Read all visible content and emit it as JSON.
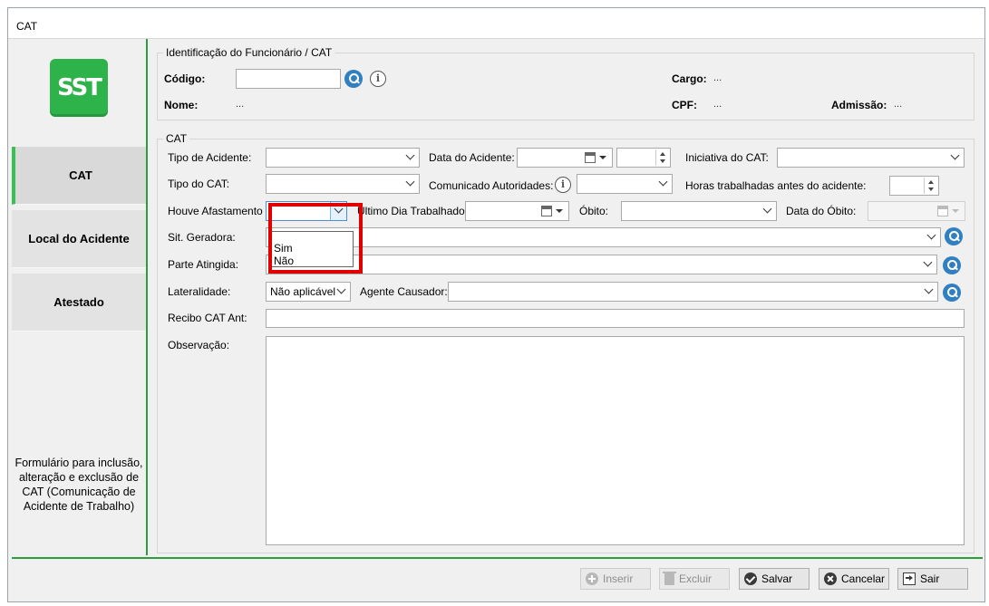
{
  "window": {
    "title": "CAT"
  },
  "sidebar": {
    "logo_text": "SST",
    "logo_color": "#2db34a",
    "items": [
      {
        "label": "CAT",
        "active": true
      },
      {
        "label": "Local do Acidente",
        "active": false
      },
      {
        "label": "Atestado",
        "active": false
      }
    ],
    "description": "Formulário para inclusão, alteração e exclusão de CAT (Comunicação de Acidente de Trabalho)"
  },
  "identificacao": {
    "legend": "Identificação do Funcionário / CAT",
    "codigo_label": "Código:",
    "codigo_value": "",
    "nome_label": "Nome:",
    "nome_value": "...",
    "cargo_label": "Cargo:",
    "cargo_value": "...",
    "cpf_label": "CPF:",
    "cpf_value": "...",
    "admissao_label": "Admissão:",
    "admissao_value": "..."
  },
  "cat": {
    "legend": "CAT",
    "tipo_acidente_label": "Tipo de Acidente:",
    "tipo_acidente_value": "",
    "data_acidente_label": "Data do Acidente:",
    "data_acidente_value": "",
    "hora_acidente_value": "",
    "iniciativa_label": "Iniciativa do CAT:",
    "iniciativa_value": "",
    "tipo_cat_label": "Tipo do CAT:",
    "tipo_cat_value": "",
    "comunicado_label": "Comunicado Autoridades:",
    "comunicado_value": "",
    "horas_label": "Horas trabalhadas antes do acidente:",
    "horas_value": "",
    "afastamento_label": "Houve Afastamento",
    "afastamento_value": "",
    "afastamento_options": [
      "Sim",
      "Não"
    ],
    "ultimo_dia_label": "Último Dia Trabalhado:",
    "ultimo_dia_value": "",
    "obito_label": "Óbito:",
    "obito_value": "",
    "data_obito_label": "Data do Óbito:",
    "data_obito_value": "",
    "sit_geradora_label": "Sit. Geradora:",
    "sit_geradora_value": "",
    "parte_atingida_label": "Parte Atingida:",
    "parte_atingida_value": "",
    "lateralidade_label": "Lateralidade:",
    "lateralidade_value": "Não aplicável",
    "agente_causador_label": "Agente Causador:",
    "agente_causador_value": "",
    "recibo_label": "Recibo CAT Ant:",
    "recibo_value": "",
    "observacao_label": "Observação:",
    "observacao_value": ""
  },
  "toolbar": {
    "inserir": "Inserir",
    "excluir": "Excluir",
    "salvar": "Salvar",
    "cancelar": "Cancelar",
    "sair": "Sair"
  },
  "colors": {
    "accent": "#2e9b3f",
    "highlight": "#e00000",
    "search": "#2f7fc1"
  }
}
